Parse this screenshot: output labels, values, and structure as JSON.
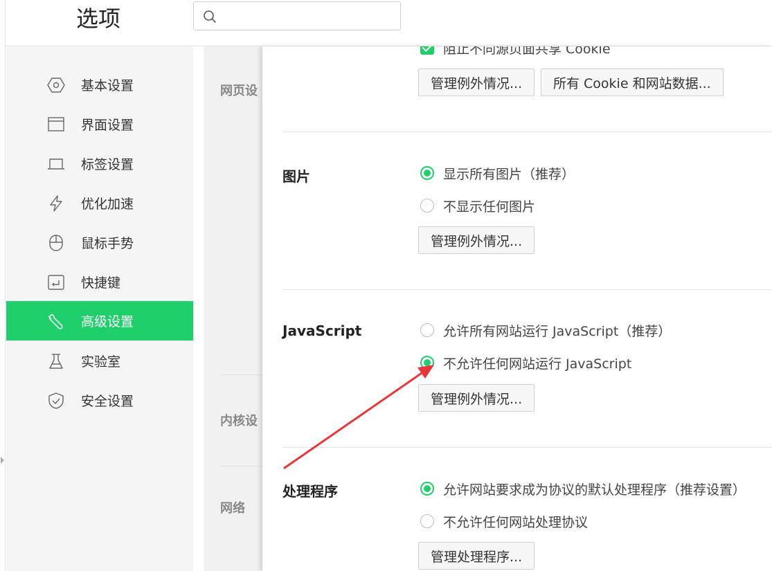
{
  "header": {
    "title": "选项",
    "search_placeholder": ""
  },
  "sidebar": {
    "items": [
      {
        "label": "基本设置",
        "icon": "hexagon-settings-icon"
      },
      {
        "label": "界面设置",
        "icon": "window-icon"
      },
      {
        "label": "标签设置",
        "icon": "tab-icon"
      },
      {
        "label": "优化加速",
        "icon": "lightning-icon"
      },
      {
        "label": "鼠标手势",
        "icon": "mouse-icon"
      },
      {
        "label": "快捷键",
        "icon": "keyboard-shortcut-icon"
      },
      {
        "label": "高级设置",
        "icon": "wrench-icon",
        "active": true
      },
      {
        "label": "实验室",
        "icon": "flask-icon"
      },
      {
        "label": "安全设置",
        "icon": "shield-icon"
      }
    ]
  },
  "mid": {
    "labels": [
      "网页设",
      "内核设",
      "网络"
    ]
  },
  "panel": {
    "cookie": {
      "checkbox_label": "阻止不同源页面共享 Cookie",
      "btn_exceptions": "管理例外情况...",
      "btn_all_cookies": "所有 Cookie 和网站数据..."
    },
    "images": {
      "title": "图片",
      "opt1": "显示所有图片（推荐）",
      "opt2": "不显示任何图片",
      "btn": "管理例外情况..."
    },
    "javascript": {
      "title": "JavaScript",
      "opt1": "允许所有网站运行 JavaScript（推荐）",
      "opt2": "不允许任何网站运行 JavaScript",
      "btn": "管理例外情况..."
    },
    "handlers": {
      "title": "处理程序",
      "opt1": "允许网站要求成为协议的默认处理程序（推荐设置）",
      "opt2": "不允许任何网站处理协议",
      "btn": "管理处理程序..."
    }
  },
  "colors": {
    "accent": "#1fcf6b",
    "annotation_arrow": "#e8363a"
  }
}
